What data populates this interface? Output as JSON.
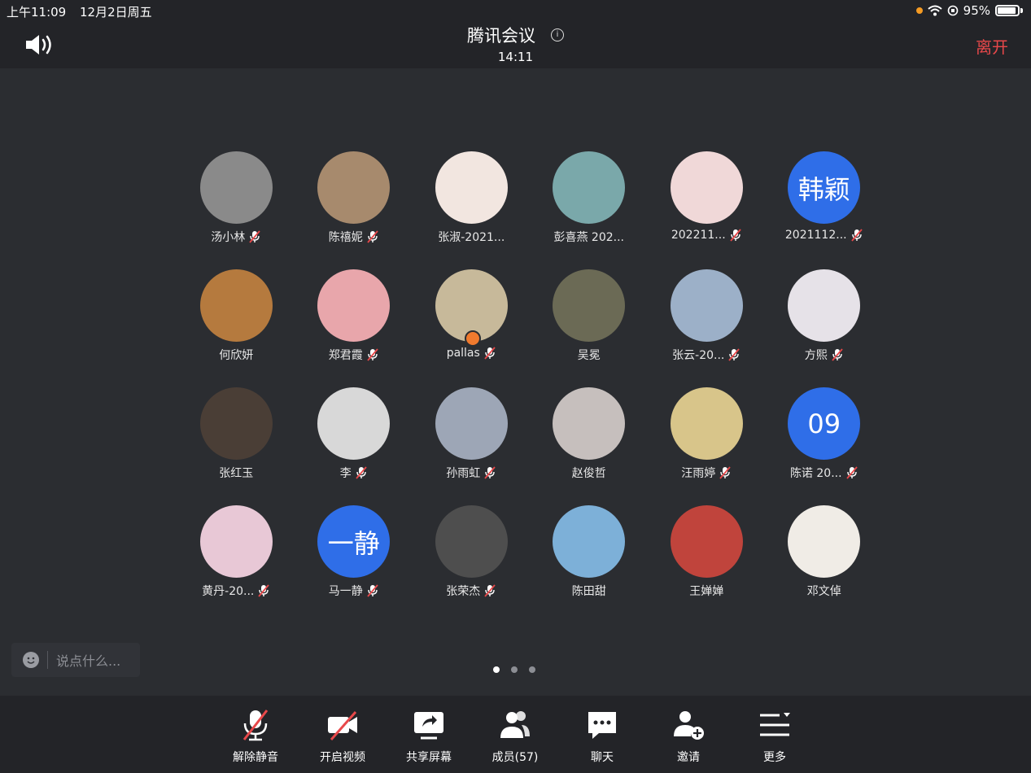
{
  "status": {
    "time": "上午11:09",
    "date": "12月2日周五",
    "battery": "95%"
  },
  "header": {
    "title": "腾讯会议",
    "timer": "14:11",
    "leave": "离开"
  },
  "participants": [
    {
      "name": "汤小林",
      "muted": true,
      "avatar": "#8a8a8a",
      "text": ""
    },
    {
      "name": "陈禧妮",
      "muted": true,
      "avatar": "#a78a6d",
      "text": ""
    },
    {
      "name": "张淑-2021...",
      "muted": false,
      "avatar": "#f2e6e0",
      "text": ""
    },
    {
      "name": "彭喜燕 202...",
      "muted": false,
      "avatar": "#7aa8aa",
      "text": ""
    },
    {
      "name": "202211...",
      "muted": true,
      "avatar": "#f0d8d8",
      "text": ""
    },
    {
      "name": "2021112...",
      "muted": true,
      "avatar": "#2f6ee8",
      "text": "韩颖"
    },
    {
      "name": "何欣妍",
      "muted": false,
      "avatar": "#b57a3e",
      "text": ""
    },
    {
      "name": "郑君霞",
      "muted": true,
      "avatar": "#e8a6ab",
      "text": ""
    },
    {
      "name": "pallas",
      "muted": true,
      "avatar": "#c7b99a",
      "text": "",
      "host": true
    },
    {
      "name": "吴冕",
      "muted": false,
      "avatar": "#6b6a55",
      "text": ""
    },
    {
      "name": "张云-20...",
      "muted": true,
      "avatar": "#9cb0c8",
      "text": ""
    },
    {
      "name": "方熙",
      "muted": true,
      "avatar": "#e6e2e8",
      "text": ""
    },
    {
      "name": "张红玉",
      "muted": false,
      "avatar": "#4a3e36",
      "text": ""
    },
    {
      "name": "李",
      "muted": true,
      "avatar": "#d8d8d8",
      "text": ""
    },
    {
      "name": "孙雨虹",
      "muted": true,
      "avatar": "#9da6b6",
      "text": ""
    },
    {
      "name": "赵俊哲",
      "muted": false,
      "avatar": "#c6bfbd",
      "text": ""
    },
    {
      "name": "汪雨婷",
      "muted": true,
      "avatar": "#d8c58a",
      "text": ""
    },
    {
      "name": "陈诺 20...",
      "muted": true,
      "avatar": "#2f6ee8",
      "text": "09"
    },
    {
      "name": "黄丹-20...",
      "muted": true,
      "avatar": "#e8c8d6",
      "text": ""
    },
    {
      "name": "马一静",
      "muted": true,
      "avatar": "#2f6ee8",
      "text": "一静"
    },
    {
      "name": "张荣杰",
      "muted": true,
      "avatar": "#4e4e4e",
      "text": ""
    },
    {
      "name": "陈田甜",
      "muted": false,
      "avatar": "#7db0d8",
      "text": ""
    },
    {
      "name": "王婵婵",
      "muted": false,
      "avatar": "#c0443c",
      "text": ""
    },
    {
      "name": "邓文倬",
      "muted": false,
      "avatar": "#f0ece6",
      "text": ""
    }
  ],
  "chat": {
    "placeholder": "说点什么..."
  },
  "toolbar": {
    "unmute": "解除静音",
    "video": "开启视频",
    "share": "共享屏幕",
    "members": "成员(57)",
    "chat": "聊天",
    "invite": "邀请",
    "more": "更多"
  },
  "colors": {
    "accent_red": "#e8484a",
    "avatar_blue": "#2f6ee8",
    "background": "#2b2d31",
    "bar": "#232428"
  }
}
